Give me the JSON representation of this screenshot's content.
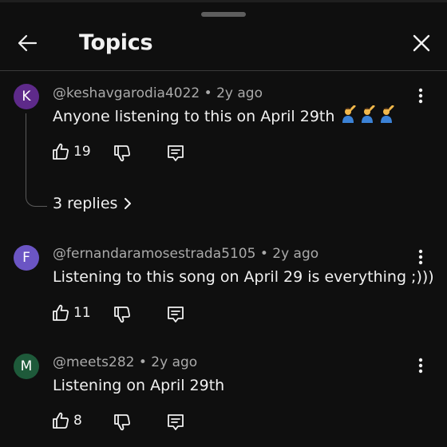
{
  "header": {
    "title": "Topics"
  },
  "comments": [
    {
      "avatar_letter": "K",
      "avatar_color": "#5e2a8a",
      "author": "@keshavgarodia4022",
      "time": "2y ago",
      "text": "Anyone listening to this on April 29th",
      "emoji": [
        "person-raising-hand",
        "person-raising-hand",
        "person-raising-hand"
      ],
      "likes": "19",
      "replies": "3 replies"
    },
    {
      "avatar_letter": "F",
      "avatar_color": "#6b55c4",
      "author": "@fernandaramosestrada5105",
      "time": "2y ago",
      "text": "Listening to this song on April 29 is everything ;)))",
      "likes": "11"
    },
    {
      "avatar_letter": "M",
      "avatar_color": "#1e5a3a",
      "author": "@meets282",
      "time": "2y ago",
      "text": "Listening on April 29th",
      "likes": "8"
    }
  ],
  "meta_separator": "•"
}
